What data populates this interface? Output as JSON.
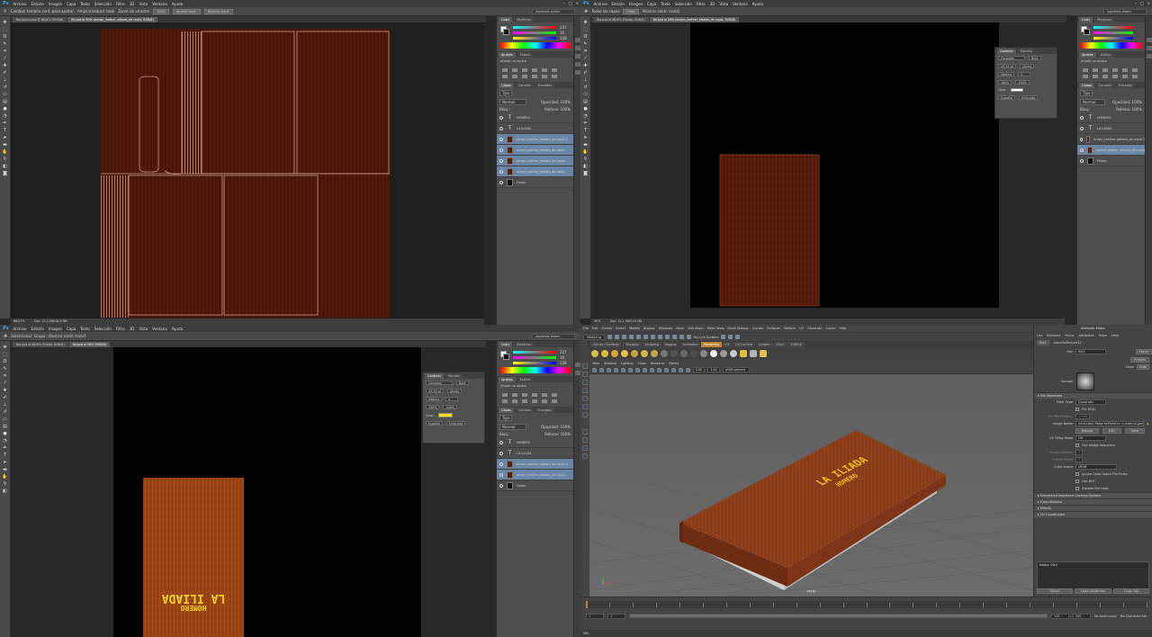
{
  "ps": {
    "logo": "Ps",
    "menu": [
      "Archivo",
      "Edición",
      "Imagen",
      "Capa",
      "Texto",
      "Selección",
      "Filtro",
      "3D",
      "Vista",
      "Ventana",
      "Ayuda"
    ],
    "essentials": "Aspectos esenc.",
    "options_q1": [
      "Cambiar tamaño cent. para ajustar",
      "Ampliar/reducir todo",
      "Zoom de arrastre",
      "100%",
      "Ajustar pant.",
      "Rellenar pant."
    ],
    "options_q2": [
      "Todas las capas",
      "Crear",
      "Mostrar contr. transf."
    ],
    "options_q3": [
      "Seleccionar: Grupo",
      "Mostrar contr. transf."
    ],
    "tab_q1": [
      "fbx.blend.psd @ 66,6% (RGB/8)",
      "fbl.psd al 50% (brown_leather_albedo_do copia, RGB/8)"
    ],
    "tab_q2": [
      "fbx.psd al 66,6% (Fondo, RGB/8)",
      "fbl.psd al 50% (brown_leather_albedo_do copia, RGB/8)"
    ],
    "tab_q3": [
      "fbx.psd al 66,6% (Fondo, RGB/8)",
      "fbl.psd al 50% (RGB/8)"
    ],
    "status_q1": [
      "66,67%",
      "Doc: 12,1 MB/18,8 MB"
    ],
    "status_q2": [
      "50%",
      "Doc: 12,1 MB/113 MB"
    ],
    "status_q3": [
      "50%",
      "Doc: 12,1 MB/113 MB"
    ],
    "panels": {
      "color_tabs": [
        "Color",
        "Muestras"
      ],
      "color_values": [
        "247",
        "16",
        "248"
      ],
      "adj_tabs": [
        "Ajustes",
        "Estilos"
      ],
      "adj_title": "Añadir un ajuste",
      "layers_tabs": [
        "Capas",
        "Canales",
        "Trazados"
      ],
      "kind": "Tipo",
      "blend": "Normal",
      "opacity": "Opacidad: 100%",
      "lock": "Bloq.:",
      "fill": "Relleno: 100%",
      "layers_q1": [
        {
          "name": "HOMERO",
          "kind": "text",
          "sel": false
        },
        {
          "name": "LA ILIADA",
          "kind": "text",
          "sel": false
        },
        {
          "name": "brown_leather_albedo_do copia 2",
          "kind": "leather",
          "sel": true
        },
        {
          "name": "brown_leather_albedo_do copia",
          "kind": "leather",
          "sel": true
        },
        {
          "name": "brown_leather_albedo_do copia",
          "kind": "leather",
          "sel": true
        },
        {
          "name": "brown_leather_albedo_do copia",
          "kind": "leather",
          "sel": true
        },
        {
          "name": "Fondo",
          "kind": "bg",
          "sel": false
        }
      ],
      "layers_q2": [
        {
          "name": "HOMERO",
          "kind": "text",
          "sel": false
        },
        {
          "name": "LA ILIADA",
          "kind": "text",
          "sel": false
        },
        {
          "name": "brown_leather_albedo_do copia 2",
          "kind": "leather",
          "sel": false
        },
        {
          "name": "brown_leather_albedo_do copia",
          "kind": "leather",
          "sel": true
        },
        {
          "name": "Fondo",
          "kind": "bg",
          "sel": false
        }
      ],
      "layers_q3": [
        {
          "name": "HOMERO",
          "kind": "text",
          "sel": false
        },
        {
          "name": "LA ILIADA",
          "kind": "text",
          "sel": false
        },
        {
          "name": "brown_leather_albedo_do copia 2",
          "kind": "leather",
          "sel": true
        },
        {
          "name": "brown_leather_albedo_do copia",
          "kind": "leather",
          "sel": true
        },
        {
          "name": "Fondo",
          "kind": "bg",
          "sel": false
        }
      ],
      "char_tabs": [
        "Carácter",
        "Párrafo"
      ],
      "char_font": "Consolas",
      "char_style": "Bold",
      "char_size": "43,34 pt",
      "char_leading": "(Auto)",
      "char_kern": "Métrica",
      "char_track": "0",
      "char_scale": "100%",
      "char_color_label": "Color:",
      "char_lang": "Español",
      "char_aa": "Enfocado",
      "char_color": "#f2e600"
    },
    "cover_title": "LA ILIADA",
    "cover_author": "HOMERO"
  },
  "maya": {
    "menu": [
      "File",
      "Edit",
      "Create",
      "Select",
      "Modify",
      "Display",
      "Windows",
      "Mesh",
      "Edit Mesh",
      "Mesh Tools",
      "Mesh Display",
      "Curves",
      "Surfaces",
      "Deform",
      "UV",
      "Generate",
      "Cache",
      "Help"
    ],
    "mode": "Modeling",
    "no_live": "No Live Surface",
    "shelf_tabs": [
      "Curves / Surfaces",
      "Polygons",
      "Sculpting",
      "Rigging",
      "Animation",
      "Rendering",
      "FX",
      "FX Caching",
      "Custom",
      "XGen",
      "TURTLE"
    ],
    "shelf_active": "Rendering",
    "vp_menu": [
      "View",
      "Shading",
      "Lighting",
      "Show",
      "Renderer",
      "Panels"
    ],
    "gamma": "sRGB gamma",
    "exposure": "0.00",
    "gammaval": "1.00",
    "camera": "persp",
    "book_title": "LA ILIADA",
    "book_author": "HOMERO",
    "ae": {
      "header": "Attribute Editor",
      "menus": [
        "List",
        "Selected",
        "Focus",
        "Attributes",
        "Show",
        "Help"
      ],
      "tab": "file2",
      "node_tab": "place2dTexture12",
      "file_label": "file:",
      "file_value": "file2",
      "focus": "Focus",
      "presets": "Presets",
      "show": "Show",
      "hide": "Hide",
      "sample": "Sample",
      "section": "File Attributes",
      "filter_type_label": "Filter Type",
      "filter_type": "Quadratic",
      "pre_filter": "Pre Filter",
      "pre_filter_radius": "Pre Filter Radius",
      "pre_filter_radius_val": "2.000",
      "image_name_label": "Image Name",
      "image_name": "ents\\Libro Roberto\\Referen Cuaderno.jpeg",
      "reload": "Reload",
      "edit": "Edit",
      "view": "View",
      "uv_tiling_label": "UV Tiling Mode",
      "uv_tiling": "Off",
      "use_image_seq": "Use Image Sequence",
      "image_number": "Image Number",
      "image_number_val": "1",
      "frame_offset": "Frame Offset",
      "frame_offset_val": "0",
      "color_space_label": "Color Space",
      "color_space": "sRGB",
      "ignore_cs": "Ignore Color Space File Rules",
      "use_bot": "Use BOT",
      "disable_fl": "Disable File Load",
      "sections": [
        "Interactive Sequence Caching Options",
        "Color Balance",
        "Effects",
        "UV Coordinates"
      ],
      "notes": "Notes: file2",
      "select": "Select",
      "load_attrs": "Load Attributes",
      "copy_tab": "Copy Tab"
    },
    "timeline": {
      "start": "1",
      "end": "120",
      "current": "1",
      "range_start": "1",
      "range_end": "120",
      "range_max": "200",
      "anim_layer": "No Anim Layer",
      "char_set": "No Character Set"
    },
    "mel": "MEL"
  }
}
